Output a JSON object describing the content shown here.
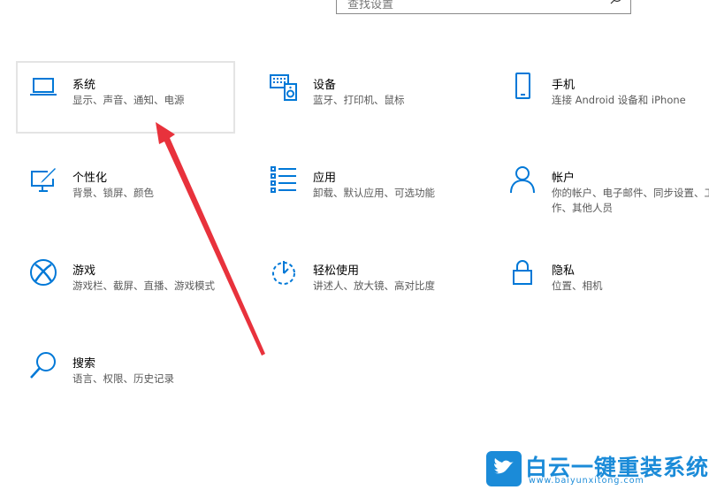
{
  "search": {
    "placeholder": "查找设置"
  },
  "tiles": [
    {
      "title": "系统",
      "desc": "显示、声音、通知、电源",
      "icon": "laptop-icon",
      "selected": true
    },
    {
      "title": "设备",
      "desc": "蓝牙、打印机、鼠标",
      "icon": "keyboard-speaker-icon"
    },
    {
      "title": "手机",
      "desc": "连接 Android 设备和 iPhone",
      "icon": "phone-icon"
    },
    {
      "title": "个性化",
      "desc": "背景、锁屏、颜色",
      "icon": "paint-monitor-icon"
    },
    {
      "title": "应用",
      "desc": "卸载、默认应用、可选功能",
      "icon": "app-list-icon"
    },
    {
      "title": "帐户",
      "desc": "你的帐户、电子邮件、同步设置、工作、其他人员",
      "icon": "person-icon"
    },
    {
      "title": "游戏",
      "desc": "游戏栏、截屏、直播、游戏模式",
      "icon": "xbox-icon"
    },
    {
      "title": "轻松使用",
      "desc": "讲述人、放大镜、高对比度",
      "icon": "ease-of-access-icon"
    },
    {
      "title": "隐私",
      "desc": "位置、相机",
      "icon": "lock-icon"
    },
    {
      "title": "搜索",
      "desc": "语言、权限、历史记录",
      "icon": "search-magnifier-icon"
    }
  ],
  "colors": {
    "accent": "#0078d7",
    "arrow": "#e8323c",
    "watermark": "#1b8bd8"
  },
  "watermark": {
    "text": "白云一键重装系统",
    "url": "www.baiyunxitong.com"
  }
}
